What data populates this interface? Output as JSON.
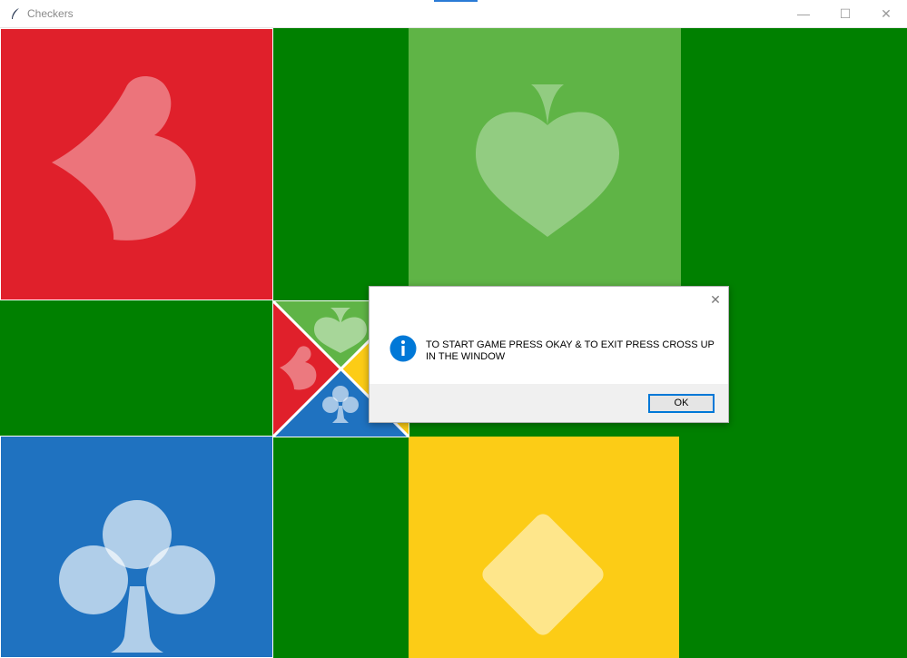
{
  "window": {
    "title": "Checkers",
    "minimize_glyph": "—",
    "maximize_glyph": "☐",
    "close_glyph": "✕"
  },
  "board": {
    "home_red": {
      "suit": "heart-icon",
      "color": "#e0202b"
    },
    "home_green": {
      "suit": "spade-icon",
      "color": "#5fb446"
    },
    "home_blue": {
      "suit": "club-icon",
      "color": "#1f72c0"
    },
    "home_yellow": {
      "suit": "diamond-icon",
      "color": "#fccc16"
    },
    "background": "#008000"
  },
  "dialog": {
    "message": "TO START GAME PRESS OKAY & TO EXIT PRESS CROSS UP IN THE WINDOW",
    "ok_label": "OK",
    "close_glyph": "✕",
    "icon": "info-icon"
  }
}
